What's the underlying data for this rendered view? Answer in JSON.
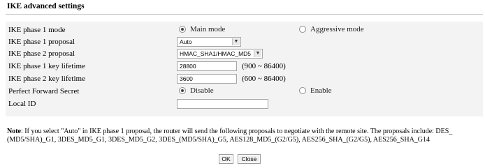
{
  "section_title": "IKE advanced settings",
  "rows": {
    "phase1_mode": {
      "label": "IKE phase 1 mode",
      "options": [
        "Main mode",
        "Aggressive mode"
      ],
      "selected": "Main mode"
    },
    "phase1_proposal": {
      "label": "IKE phase 1 proposal",
      "value": "Auto"
    },
    "phase2_proposal": {
      "label": "IKE phase 2 proposal",
      "value": "HMAC_SHA1/HMAC_MD5"
    },
    "phase1_lifetime": {
      "label": "IKE phase 1 key lifetime",
      "value": "28800",
      "range": "(900 ~ 86400)"
    },
    "phase2_lifetime": {
      "label": "IKE phase 2 key lifetime",
      "value": "3600",
      "range": "(600 ~ 86400)"
    },
    "pfs": {
      "label": "Perfect Forward Secret",
      "options": [
        "Disable",
        "Enable"
      ],
      "selected": "Disable"
    },
    "local_id": {
      "label": "Local ID",
      "value": ""
    }
  },
  "note": {
    "label": "Note",
    "line1": ": If you select \"Auto\" in IKE phase 1 proposal, the router will send the following proposals to negotiate with the remote site. The proposals include: DES_",
    "line2": "(MD5/SHA)_G1, 3DES_MD5_G1, 3DES_MD5_G2, 3DES_(MD5/SHA)_G5, AES128_MD5_(G2/G5), AES256_SHA_(G2/G5), AES256_SHA_G14"
  },
  "buttons": {
    "ok": "OK",
    "close": "Close"
  }
}
